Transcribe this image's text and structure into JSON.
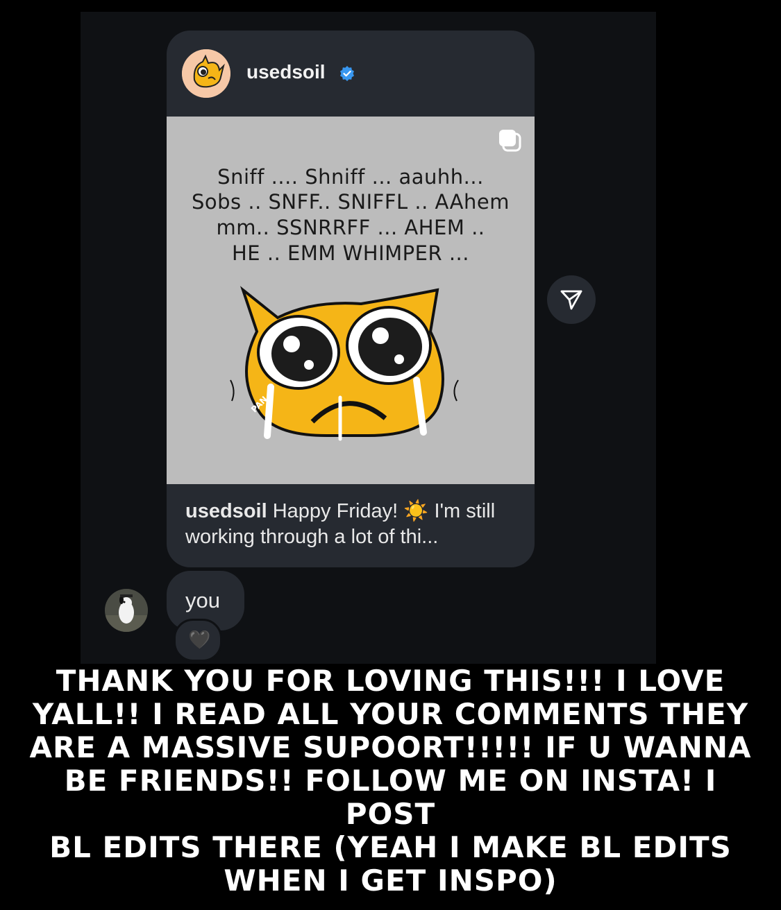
{
  "post": {
    "author": "usedsoil",
    "verified_icon": "verified-badge-icon",
    "image_text_lines": [
      "Sniff .... Shniff ... aauhh...",
      "Sobs .. SNFF.. SNIFFL .. AAhem",
      "mm.. SSNRRFF ... AHEM ..",
      "HE .. EMM WHIMPER ..."
    ],
    "image_signature": "PAN",
    "caption_author": "usedsoil",
    "caption_text": "Happy Friday! ☀️ I'm still working through a lot of thi..."
  },
  "message": {
    "text": "you",
    "reaction": "🖤"
  },
  "overlay_lines": [
    "THANK YOU FOR LOVING THIS!!! I LOVE",
    "YALL!! I READ ALL YOUR COMMENTS THEY",
    "ARE A MASSIVE SUPOORT!!!!!  IF U WANNA",
    "BE FRIENDS!! FOLLOW ME ON INSTA! I POST",
    "BL EDITS THERE (YEAH I MAKE BL EDITS",
    "WHEN I GET INSPO)"
  ],
  "colors": {
    "background": "#000000",
    "panel": "#0f1114",
    "bubble": "#262a31",
    "verified": "#3897f0",
    "creature": "#f5b517"
  }
}
